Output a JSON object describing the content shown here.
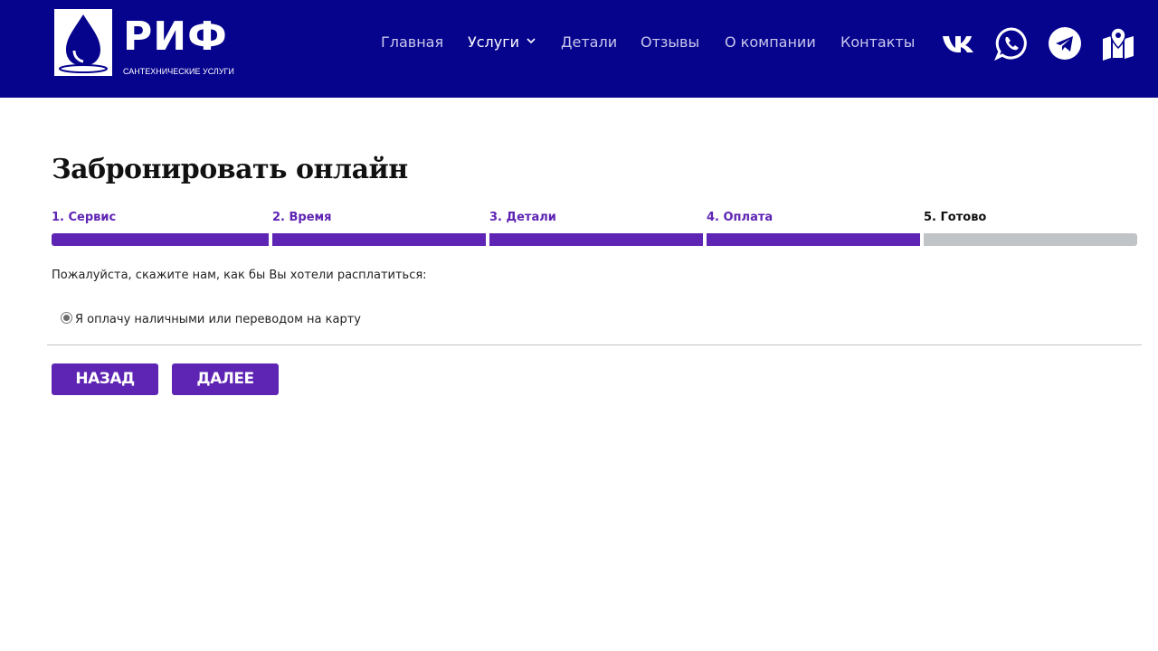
{
  "colors": {
    "header_bg": "#06038d",
    "accent": "#5e24b3",
    "step_inactive": "#c1c4c7"
  },
  "logo": {
    "name": "РИФ",
    "tagline": "САНТЕХНИЧЕСКИЕ УСЛУГИ"
  },
  "nav": {
    "items": [
      {
        "label": "Главная",
        "active": false
      },
      {
        "label": "Услуги",
        "active": true,
        "has_dropdown": true
      },
      {
        "label": "Детали",
        "active": false
      },
      {
        "label": "Отзывы",
        "active": false
      },
      {
        "label": "О компании",
        "active": false
      },
      {
        "label": "Контакты",
        "active": false
      }
    ]
  },
  "social": [
    "vk-icon",
    "whatsapp-icon",
    "telegram-icon",
    "map-icon"
  ],
  "booking": {
    "title": "Забронировать онлайн",
    "steps": [
      {
        "label": "1. Сервис",
        "done": true
      },
      {
        "label": "2. Время",
        "done": true
      },
      {
        "label": "3. Детали",
        "done": true
      },
      {
        "label": "4. Оплата",
        "done": true
      },
      {
        "label": "5. Готово",
        "done": false
      }
    ],
    "prompt": "Пожалуйста, скажите нам, как бы Вы хотели расплатиться:",
    "payment_option": {
      "label": "Я оплачу наличными или переводом на карту",
      "selected": true
    },
    "back_label": "НАЗАД",
    "next_label": "ДАЛЕЕ"
  }
}
